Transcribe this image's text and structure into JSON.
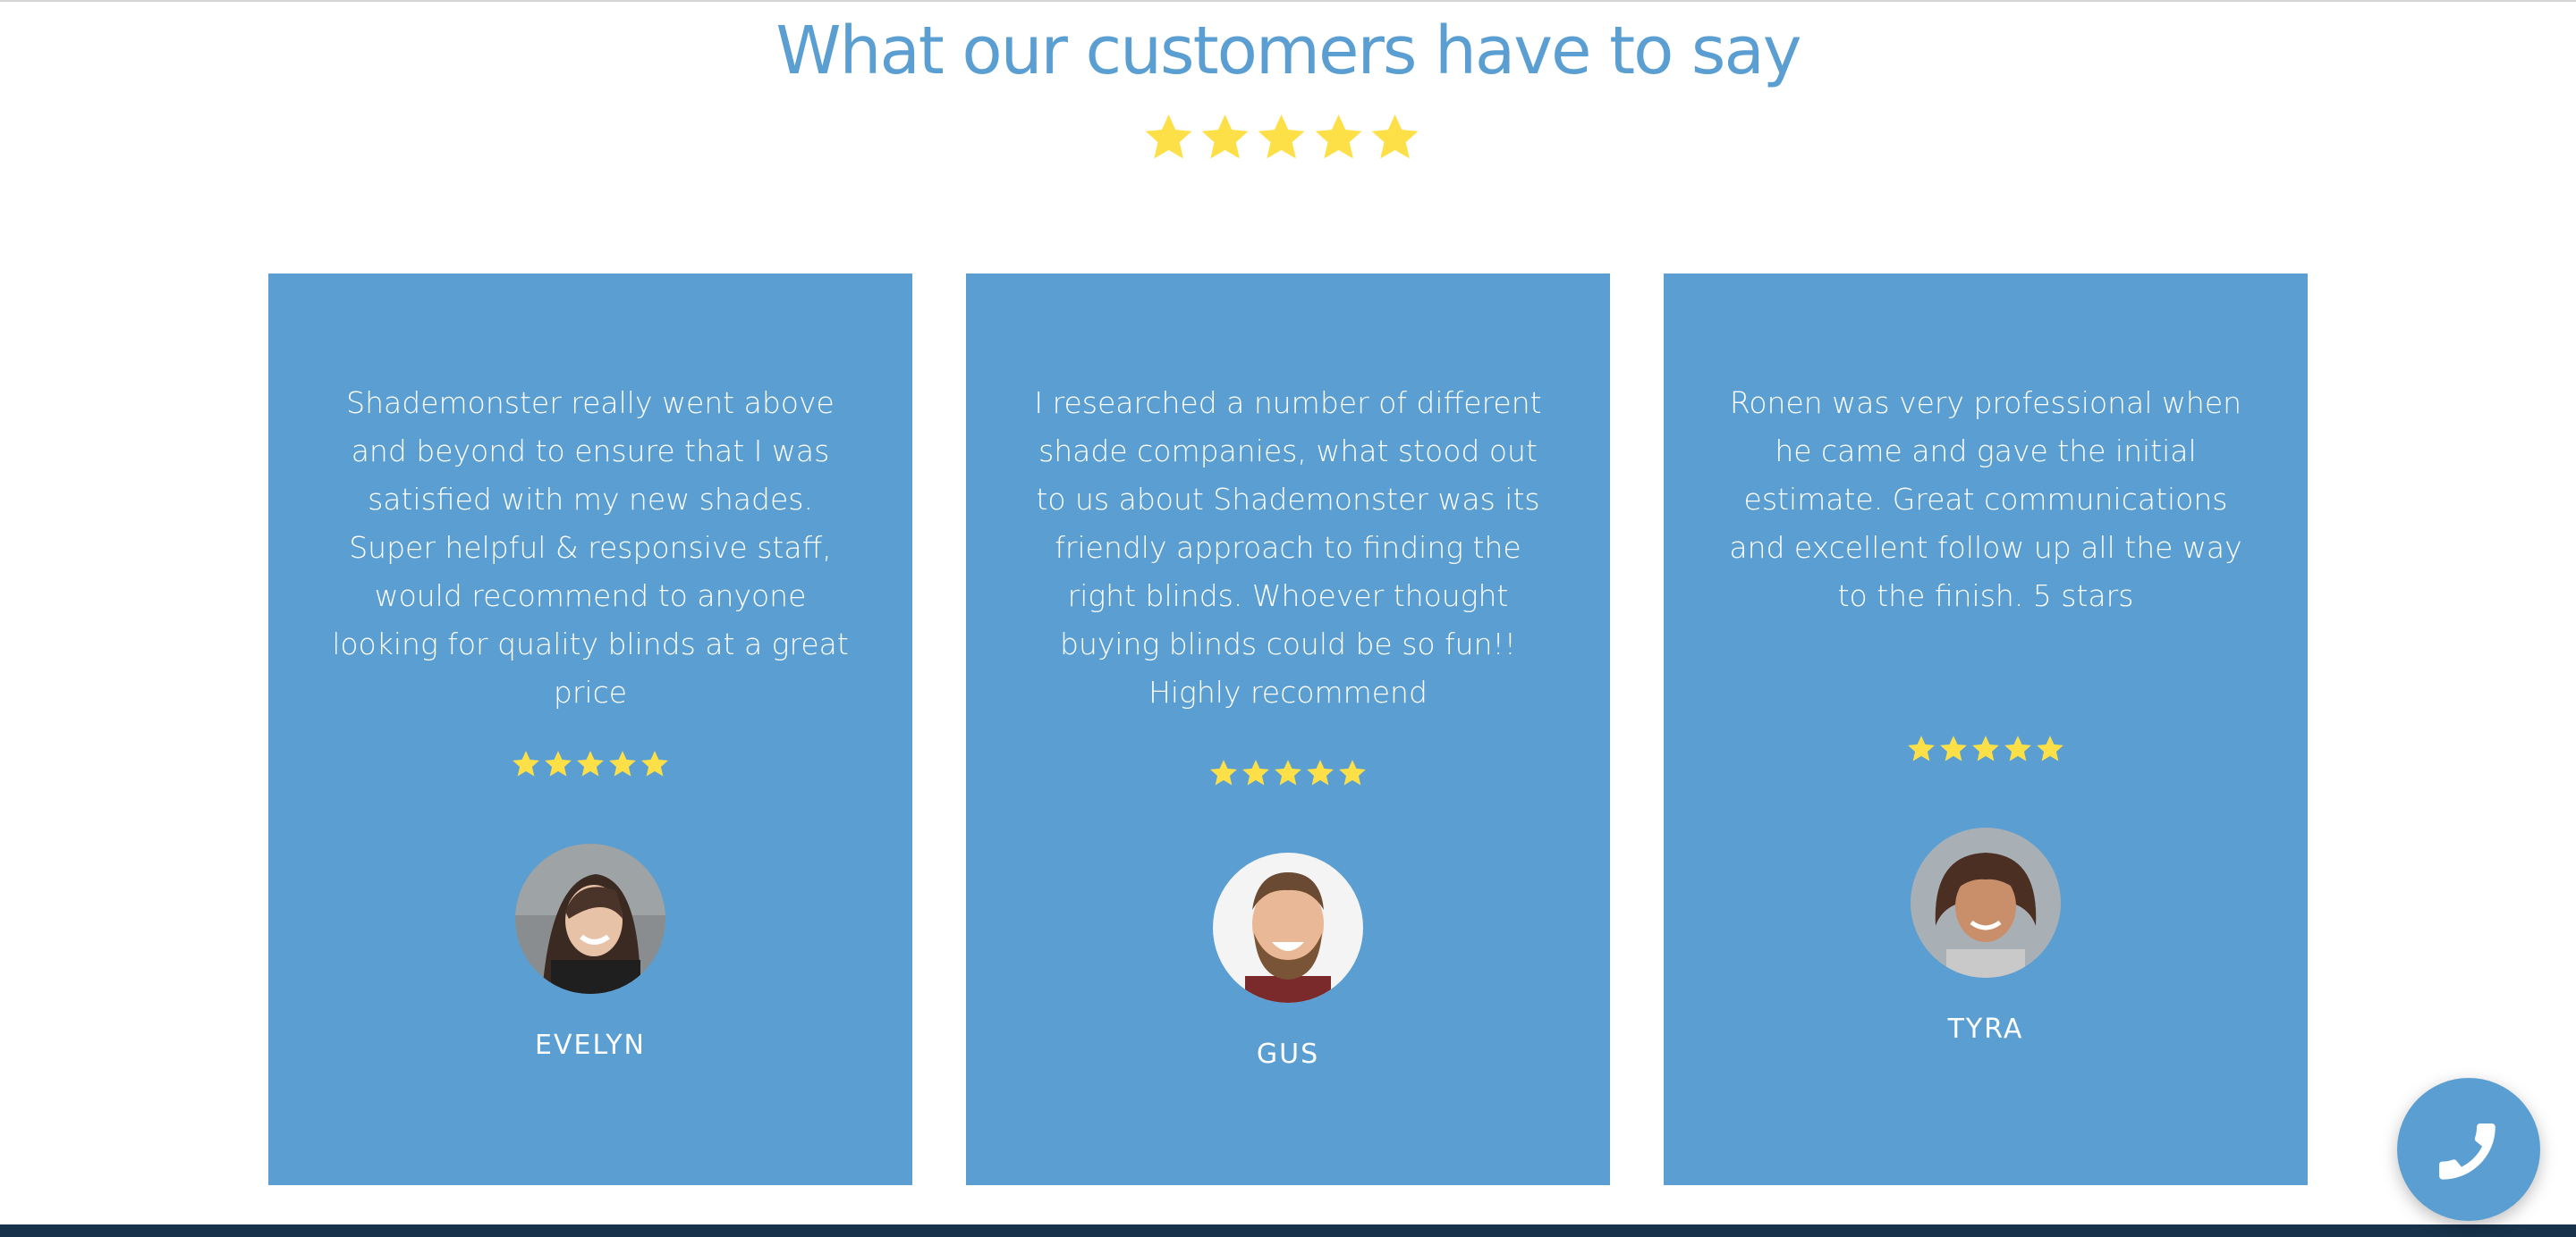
{
  "section": {
    "title": "What our customers have to say",
    "rating": 5
  },
  "colors": {
    "accent": "#5b9fd2",
    "star": "#fde047",
    "card_text": "#ffffff"
  },
  "testimonials": [
    {
      "quote": "Shademonster really went above and beyond to ensure that  I was satisfied with my new shades. Super helpful & responsive staff, would recommend to anyone looking for quality blinds at a great price",
      "rating": 5,
      "name": "EVELYN"
    },
    {
      "quote": "I researched a number of different shade companies, what stood out to us about Shademonster was its friendly approach to finding the right blinds. Whoever thought buying blinds could be so fun!!\nHighly recommend",
      "rating": 5,
      "name": "GUS"
    },
    {
      "quote": "Ronen was very professional when he came and gave the initial estimate. Great communications and excellent follow up all the way to the finish. 5 stars",
      "rating": 5,
      "name": "TYRA"
    }
  ],
  "icons": {
    "call": "phone-icon",
    "rating": "star-icon"
  }
}
